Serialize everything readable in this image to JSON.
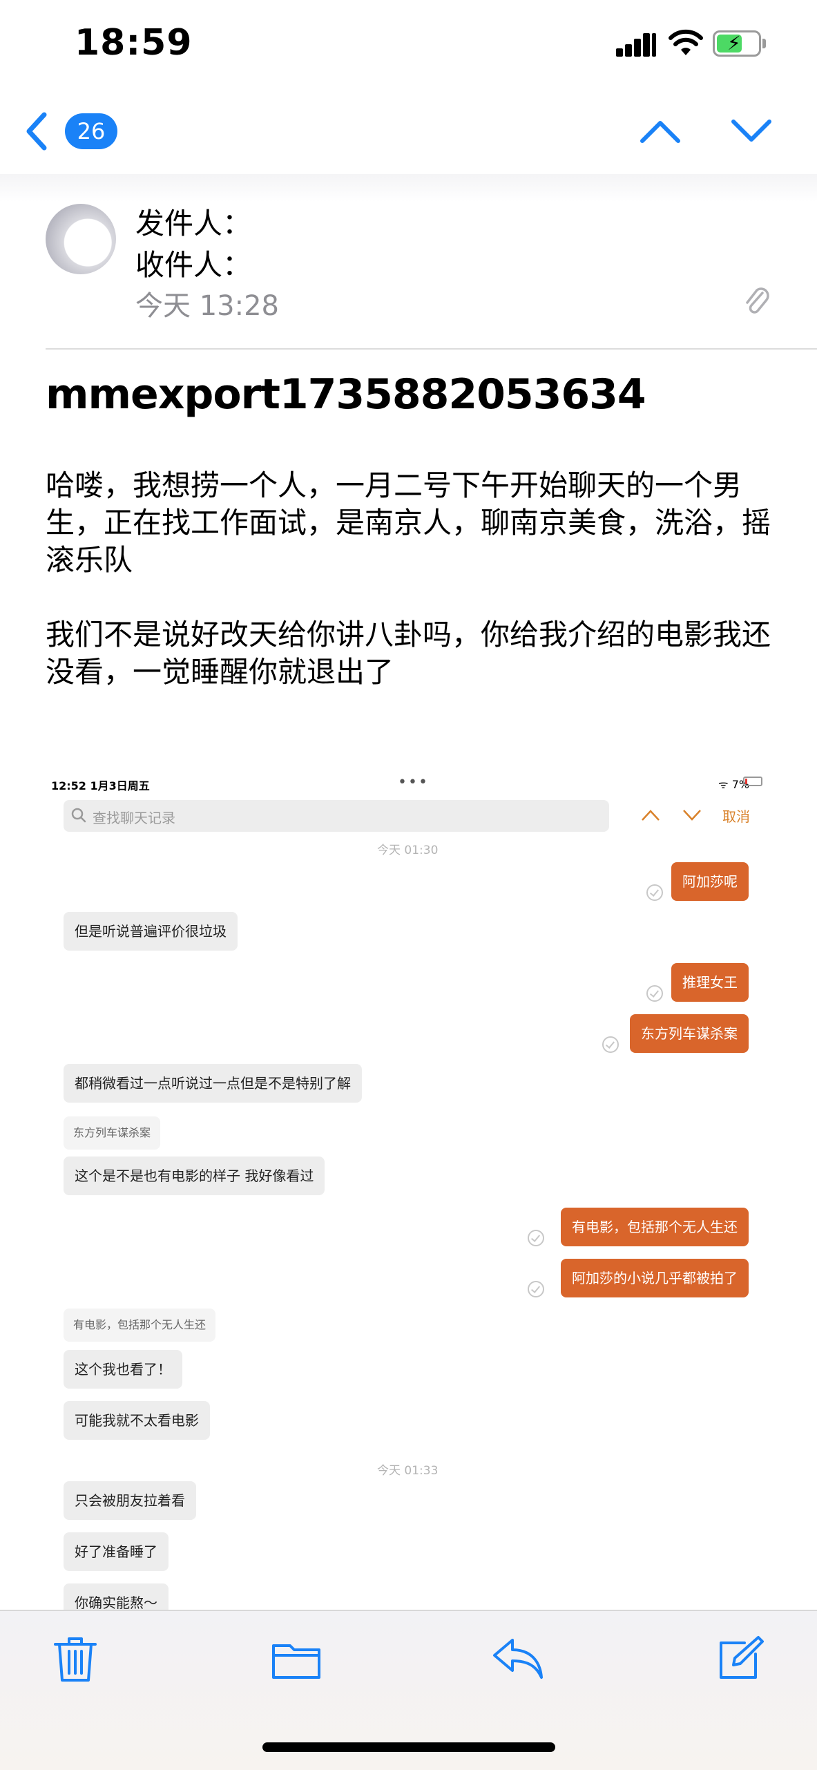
{
  "status_bar": {
    "time": "18:59"
  },
  "nav": {
    "unread_count": "26"
  },
  "header": {
    "from_label": "发件人：",
    "to_label": "收件人：",
    "date": "今天 13:28"
  },
  "subject": "mmexport1735882053634",
  "body": {
    "paragraph_1": "哈喽，我想捞一个人，一月二号下午开始聊天的一个男生，正在找工作面试，是南京人，聊南京美食，洗浴，摇滚乐队",
    "paragraph_2": "我们不是说好改天给你讲八卦吗，你给我介绍的电影我还没看，一觉睡醒你就退出了"
  },
  "embedded": {
    "status_time": "12:52  1月3日周五",
    "battery": "7%",
    "search_placeholder": "查找聊天记录",
    "cancel_label": "取消",
    "timestamp_1": "今天 01:30",
    "timestamp_2": "今天 01:33",
    "messages": [
      {
        "side": "right",
        "text": "阿加莎呢"
      },
      {
        "side": "left",
        "text": "但是听说普遍评价很垃圾"
      },
      {
        "side": "right",
        "text": "推理女王"
      },
      {
        "side": "right",
        "text": "东方列车谋杀案"
      },
      {
        "side": "left",
        "text": "都稍微看过一点听说过一点但是不是特别了解"
      },
      {
        "side": "quote",
        "text": "东方列车谋杀案"
      },
      {
        "side": "left",
        "text": "这个是不是也有电影的样子 我好像看过"
      },
      {
        "side": "right",
        "text": "有电影，包括那个无人生还"
      },
      {
        "side": "right",
        "text": "阿加莎的小说几乎都被拍了"
      },
      {
        "side": "quote",
        "text": "有电影，包括那个无人生还"
      },
      {
        "side": "left",
        "text": "这个我也看了！"
      },
      {
        "side": "left",
        "text": "可能我就不太看电影"
      },
      {
        "side": "left",
        "text": "只会被朋友拉着看"
      },
      {
        "side": "left",
        "text": "好了准备睡了"
      },
      {
        "side": "left",
        "text": "你确实能熬～"
      }
    ]
  },
  "toolbar": {
    "icons": [
      "trash-icon",
      "folder-icon",
      "reply-icon",
      "compose-icon"
    ]
  },
  "colors": {
    "accent_blue": "#1a82f7",
    "bubble_orange": "#d9652b",
    "bubble_grey": "#ededed"
  }
}
